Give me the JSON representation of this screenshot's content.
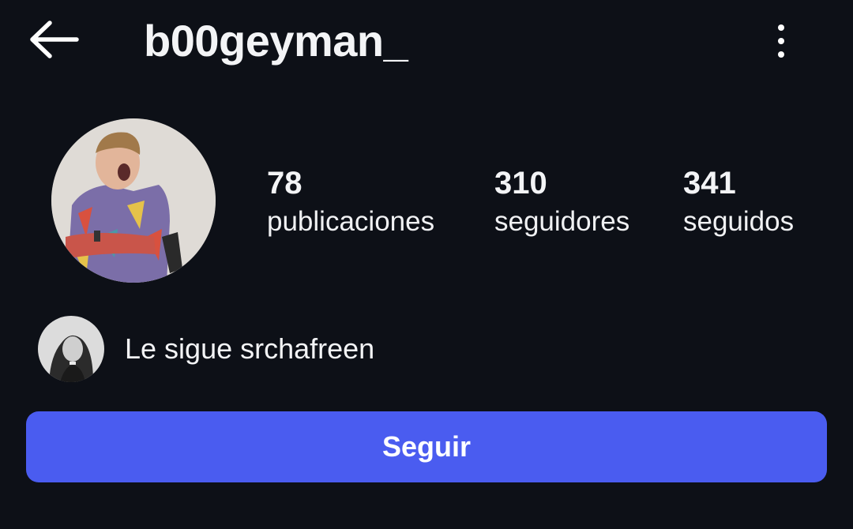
{
  "header": {
    "back_icon": "arrow-left-icon",
    "username": "b00geyman_",
    "menu_icon": "more-vertical-icon"
  },
  "profile": {
    "avatar_icon": "profile-photo",
    "stats": [
      {
        "value": "78",
        "label": "publicaciones"
      },
      {
        "value": "310",
        "label": "seguidores"
      },
      {
        "value": "341",
        "label": "seguidos"
      }
    ]
  },
  "followed_by": {
    "avatar_icon": "follower-avatar",
    "text": "Le sigue srchafreen"
  },
  "actions": {
    "follow_label": "Seguir"
  },
  "colors": {
    "background": "#0d1017",
    "primary_button": "#4a5cf0",
    "text": "#f3f4f6"
  }
}
